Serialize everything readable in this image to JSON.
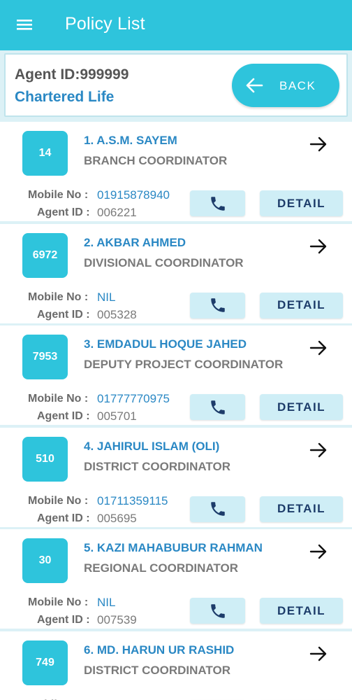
{
  "appbar": {
    "menu_icon": "hamburger-menu-icon",
    "title": "Policy List"
  },
  "agent": {
    "id_text": "Agent ID:999999",
    "company": "Chartered Life",
    "back_label": "BACK",
    "back_icon": "arrow-left-icon"
  },
  "labels": {
    "mobile": "Mobile No :",
    "agent_id": "Agent ID :",
    "detail": "DETAIL",
    "call_icon": "phone-icon",
    "open_icon": "arrow-right-icon"
  },
  "colors": {
    "primary": "#2ec4dc",
    "link_blue": "#2a88c4",
    "button_bg": "#cfeef6",
    "button_text": "#1d3c6a",
    "divider": "#dcf1f6"
  },
  "policies": [
    {
      "badge": "14",
      "name": "1. A.S.M. SAYEM",
      "role": "BRANCH COORDINATOR",
      "mobile": "01915878940",
      "agent_id": "006221"
    },
    {
      "badge": "6972",
      "name": "2. AKBAR AHMED",
      "role": "DIVISIONAL COORDINATOR",
      "mobile": "NIL",
      "agent_id": "005328"
    },
    {
      "badge": "7953",
      "name": "3. EMDADUL HOQUE JAHED",
      "role": "DEPUTY PROJECT COORDINATOR",
      "mobile": "01777770975",
      "agent_id": "005701"
    },
    {
      "badge": "510",
      "name": "4. JAHIRUL ISLAM (OLI)",
      "role": "DISTRICT COORDINATOR",
      "mobile": "01711359115",
      "agent_id": "005695"
    },
    {
      "badge": "30",
      "name": "5. KAZI MAHABUBUR RAHMAN",
      "role": "REGIONAL COORDINATOR",
      "mobile": "NIL",
      "agent_id": "007539"
    },
    {
      "badge": "749",
      "name": "6. MD. HARUN UR RASHID",
      "role": "DISTRICT COORDINATOR",
      "mobile": "",
      "agent_id": ""
    }
  ]
}
